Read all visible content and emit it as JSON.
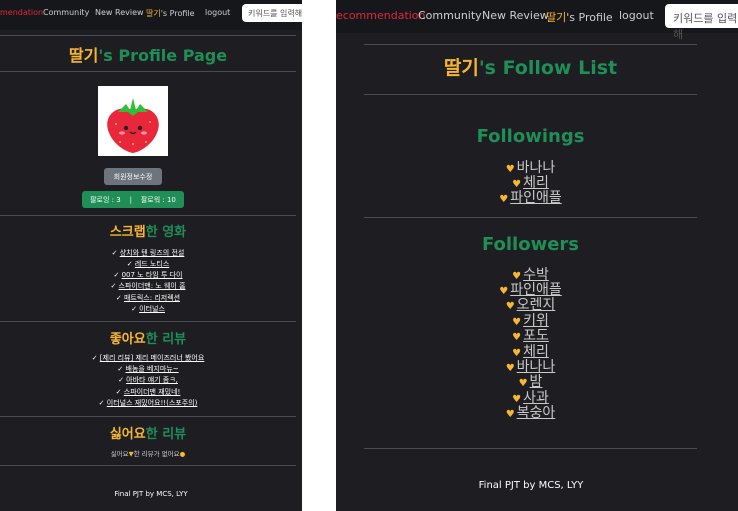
{
  "left": {
    "nav": {
      "recommendation": "mendation",
      "community": "Community",
      "new_review": "New Review",
      "profile_name": "딸기",
      "profile_suffix": "'s Profile",
      "logout": "logout",
      "search_placeholder": "키워드를 입력해"
    },
    "title": {
      "name": "딸기",
      "suffix": "'s Profile Page"
    },
    "edit_button": "회원정보수정",
    "follow_badge": "팔로잉 : 3    |    팔로워 : 10",
    "scrap": {
      "title_a": "스크랩",
      "title_b": "한 영화",
      "items": [
        "샹치와 텐 링즈의 전설",
        "레드 노티스",
        "007 노 타임 투 다이",
        "스파이더맨: 노 웨이 홈",
        "매트릭스: 리저렉션",
        "이터널스"
      ]
    },
    "liked": {
      "title_a": "좋아요",
      "title_b": "한 리뷰",
      "items": [
        "[제리 리뷰] 제리 메이즈러너 봤어요",
        "배놈을 베지마뉴~",
        "아바타 얘기 좀ㅋ,",
        "스파이더맨 재밌네!",
        "이터널스 재밌어요!!(스포주의)"
      ]
    },
    "disliked": {
      "title_a": "싫어요",
      "title_b": "한 리뷰",
      "empty_a": "싫어요",
      "empty_b": "한 리뷰가 없어요"
    },
    "footer": "Final PJT by MCS, LYY"
  },
  "right": {
    "nav": {
      "recommendation": "ecommendation",
      "community": "Community",
      "new_review": "New Review",
      "profile_name": "딸기",
      "profile_suffix": "'s Profile",
      "logout": "logout",
      "search_placeholder": "키워드를 입력해"
    },
    "title": {
      "name": "딸기",
      "suffix": "'s Follow List"
    },
    "followings_title": "Followings",
    "followings": [
      "바나나",
      "체리",
      "파인애플"
    ],
    "followers_title": "Followers",
    "followers": [
      "수박",
      "파인애플",
      "오렌지",
      "키위",
      "포도",
      "체리",
      "바나나",
      "밤",
      "사과",
      "복숭아"
    ],
    "footer": "Final PJT by MCS, LYY"
  },
  "colors": {
    "yellow": "#f7b731",
    "green": "#1f8f57",
    "red": "#e0283e",
    "background": "#1d1d22"
  },
  "icons": [
    "strawberry-avatar",
    "heart-icon",
    "check-mark",
    "thumb-down-emoji",
    "smile-emoji"
  ]
}
